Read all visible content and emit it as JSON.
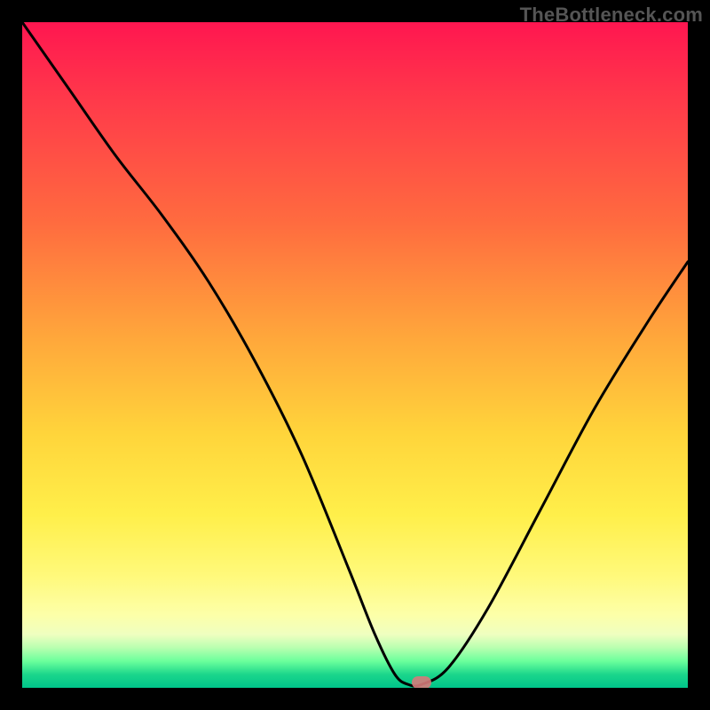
{
  "attribution": "TheBottleneck.com",
  "chart_data": {
    "type": "line",
    "title": "",
    "xlabel": "",
    "ylabel": "",
    "xlim": [
      0,
      100
    ],
    "ylim": [
      0,
      100
    ],
    "grid": false,
    "legend": false,
    "background": "vertical-rainbow-gradient",
    "series": [
      {
        "name": "bottleneck-curve",
        "x": [
          0,
          7,
          14,
          21,
          28,
          35,
          42,
          49,
          53,
          56,
          58,
          60,
          64,
          70,
          78,
          86,
          94,
          100
        ],
        "y": [
          100,
          90,
          80,
          71,
          61,
          49,
          35,
          18,
          8,
          2,
          0.5,
          0.5,
          3,
          12,
          27,
          42,
          55,
          64
        ]
      }
    ],
    "marker": {
      "x_percent": 60,
      "y_percent": 0.8,
      "label": "optimal-point"
    },
    "gradient_stops": [
      {
        "pct": 0,
        "color": "#ff1650"
      },
      {
        "pct": 12,
        "color": "#ff3a4a"
      },
      {
        "pct": 30,
        "color": "#ff6b3f"
      },
      {
        "pct": 48,
        "color": "#ffa93b"
      },
      {
        "pct": 62,
        "color": "#ffd53b"
      },
      {
        "pct": 74,
        "color": "#ffef4a"
      },
      {
        "pct": 83,
        "color": "#fff97a"
      },
      {
        "pct": 89,
        "color": "#fdffa8"
      },
      {
        "pct": 92,
        "color": "#efffc0"
      },
      {
        "pct": 94,
        "color": "#b8ffb0"
      },
      {
        "pct": 96,
        "color": "#6bff9c"
      },
      {
        "pct": 98,
        "color": "#1bd68b"
      },
      {
        "pct": 100,
        "color": "#00c48a"
      }
    ]
  }
}
